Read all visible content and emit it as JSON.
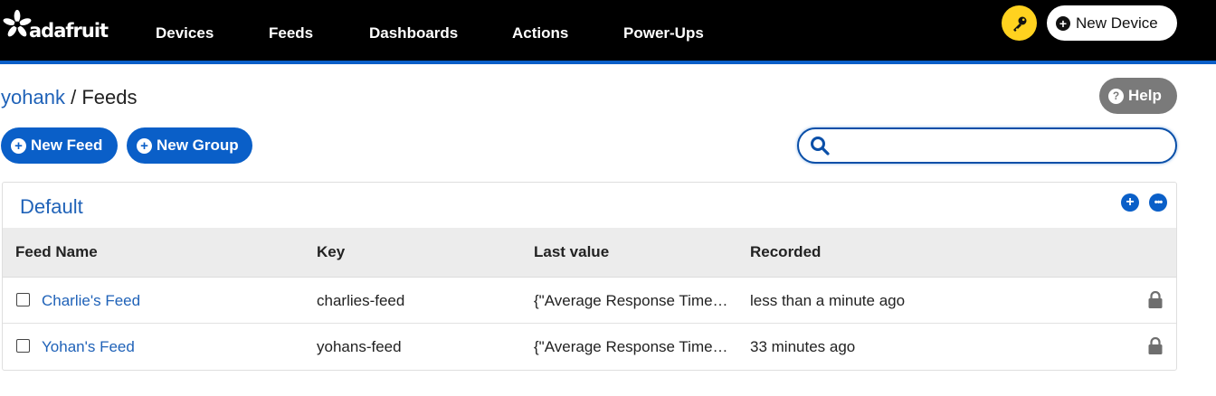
{
  "brand": {
    "logo_text": "adafruit"
  },
  "nav": {
    "items": [
      {
        "label": "Devices"
      },
      {
        "label": "Feeds"
      },
      {
        "label": "Dashboards"
      },
      {
        "label": "Actions"
      },
      {
        "label": "Power-Ups"
      }
    ],
    "key_icon": "key-icon",
    "new_device_label": "New Device"
  },
  "breadcrumb": {
    "user": "yohank",
    "separator": "/",
    "page": "Feeds"
  },
  "help": {
    "label": "Help",
    "icon": "question-icon"
  },
  "actions": {
    "new_feed_label": "New Feed",
    "new_group_label": "New Group"
  },
  "search": {
    "placeholder": "",
    "value": ""
  },
  "group": {
    "title": "Default",
    "columns": [
      "Feed Name",
      "Key",
      "Last value",
      "Recorded"
    ],
    "rows": [
      {
        "name": "Charlie's Feed",
        "key": "charlies-feed",
        "last_value": "{\"Average Response Time…",
        "recorded": "less than a minute ago"
      },
      {
        "name": "Yohan's Feed",
        "key": "yohans-feed",
        "last_value": "{\"Average Response Time…",
        "recorded": "33 minutes ago"
      }
    ]
  },
  "colors": {
    "primary": "#0a5fc8",
    "link": "#1f62b8",
    "key_button": "#ffd21f",
    "help_button": "#7a7a7a",
    "topbar": "#000000"
  }
}
